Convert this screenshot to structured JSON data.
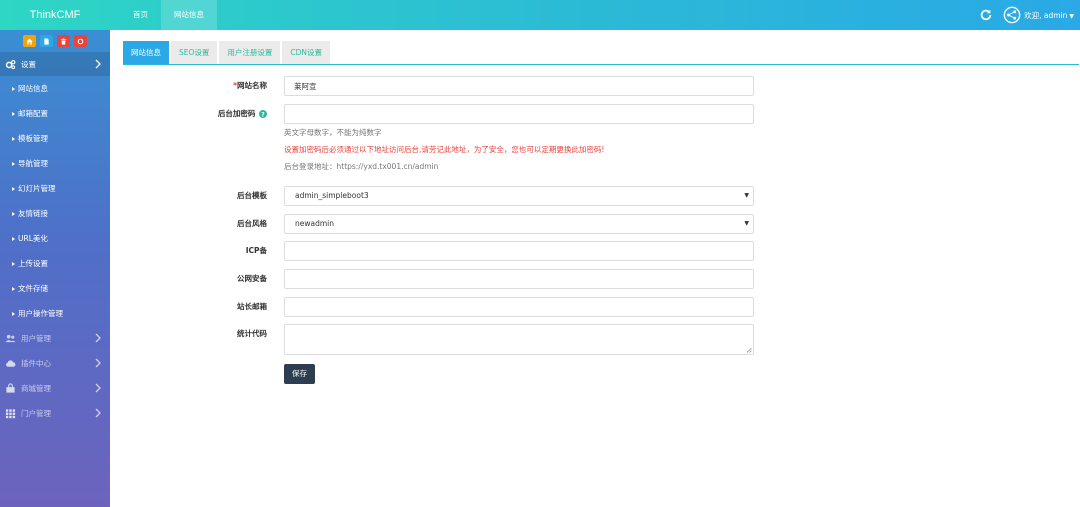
{
  "brand": "ThinkCMF",
  "topnav": [
    {
      "label": "首页",
      "active": false
    },
    {
      "label": "网站信息",
      "active": true
    }
  ],
  "user": {
    "greeting": "欢迎, admin"
  },
  "quick_buttons": [
    {
      "name": "home-icon",
      "color": "#f0a30a"
    },
    {
      "name": "file-icon",
      "color": "#2aa9e6"
    },
    {
      "name": "trash-icon",
      "color": "#e8433d"
    },
    {
      "name": "recycle-icon",
      "color": "#e8433d"
    }
  ],
  "sidebar": {
    "settings_label": "设置",
    "settings_items": [
      "网站信息",
      "邮箱配置",
      "模板管理",
      "导航管理",
      "幻灯片管理",
      "友情链接",
      "URL美化",
      "上传设置",
      "文件存储",
      "用户操作管理"
    ],
    "groups": [
      {
        "label": "用户管理",
        "icon": "users-icon"
      },
      {
        "label": "插件中心",
        "icon": "cloud-icon"
      },
      {
        "label": "商城管理",
        "icon": "shop-icon"
      },
      {
        "label": "门户管理",
        "icon": "grid-icon"
      }
    ]
  },
  "tabs": [
    {
      "label": "网站信息",
      "active": true
    },
    {
      "label": "SEO设置",
      "active": false
    },
    {
      "label": "用户注册设置",
      "active": false
    },
    {
      "label": "CDN设置",
      "active": false
    }
  ],
  "form": {
    "site_name_required": "*",
    "site_name_label": "网站名称",
    "site_name_value": "莱阿宣",
    "admin_password_label": "后台加密码",
    "admin_password_value": "",
    "hint_alnum": "英文字母数字，不能为纯数字",
    "hint_warning": "设置加密码后必须通过以下地址访问后台,请劳记此地址，为了安全，您也可以定期更换此加密码!",
    "hint_login_url": "后台登录地址：https://yxd.tx001.cn/admin",
    "admin_template_label": "后台模板",
    "admin_template_value": "admin_simpleboot3",
    "admin_style_label": "后台风格",
    "admin_style_value": "newadmin",
    "icp_label": "ICP备",
    "icp_value": "",
    "police_label": "公网安备",
    "police_value": "",
    "email_label": "站长邮箱",
    "email_value": "",
    "stats_label": "统计代码",
    "stats_value": "",
    "save_label": "保存"
  }
}
